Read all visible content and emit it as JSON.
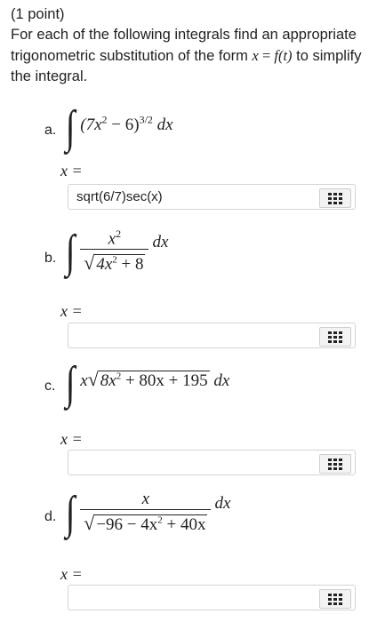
{
  "header": {
    "points": "(1 point)",
    "instructions_part1": "For each of the following integrals find an appropriate trigonometric substitution of the form",
    "form_x": "x",
    "form_eq": " = ",
    "form_f": "f",
    "form_t": "(t)",
    "instructions_part2": " to simplify the integral."
  },
  "problems": [
    {
      "label": "a.",
      "x_equals": "x =",
      "answer_value": "sqrt(6/7)sec(x)",
      "answer_placeholder": ""
    },
    {
      "label": "b.",
      "x_equals": "x =",
      "answer_value": "",
      "answer_placeholder": ""
    },
    {
      "label": "c.",
      "x_equals": "x =",
      "answer_value": "",
      "answer_placeholder": ""
    },
    {
      "label": "d.",
      "x_equals": "x =",
      "answer_value": "",
      "answer_placeholder": ""
    }
  ],
  "integrals": {
    "a": {
      "base": "(7x",
      "exp1": "2",
      "mid": " − 6)",
      "exp2": "3/2",
      "dx": "dx"
    },
    "b": {
      "num": "x",
      "num_exp": "2",
      "rad": "4x",
      "rad_exp": "2",
      "rad_tail": " + 8",
      "dx": "dx"
    },
    "c": {
      "x": "x",
      "rad": "8x",
      "rad_exp": "2",
      "rad_tail": " + 80x + 195",
      "dx": "dx"
    },
    "d": {
      "num": "x",
      "rad": "−96 − 4x",
      "rad_exp": "2",
      "rad_tail": " + 40x",
      "dx": "dx"
    }
  },
  "icons": {
    "keypad": "keypad-grid-icon"
  }
}
